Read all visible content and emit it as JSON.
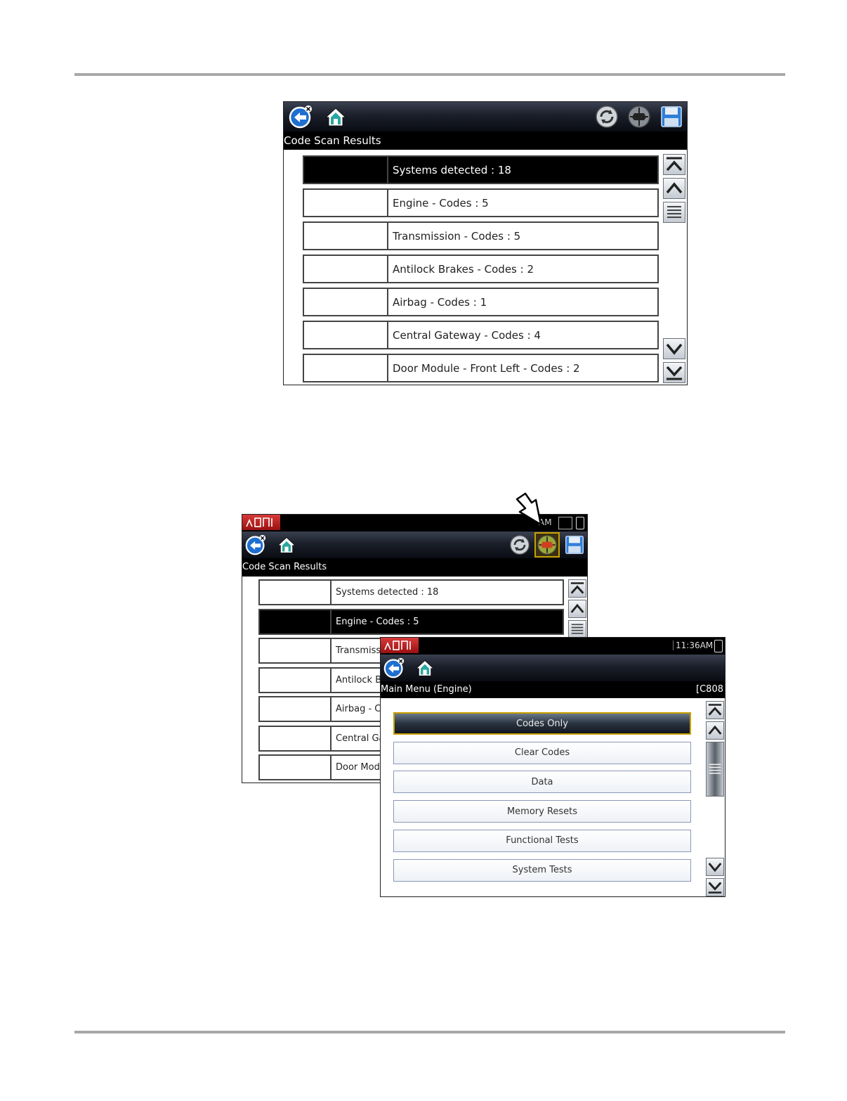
{
  "figure_top": {
    "title": "Code Scan Results",
    "rows": [
      "Systems detected : 18",
      "Engine - Codes : 5",
      "Transmission - Codes : 5",
      "Antilock Brakes - Codes : 2",
      "Airbag - Codes : 1",
      "Central Gateway - Codes : 4",
      "Door Module - Front Left - Codes : 2"
    ],
    "selected_row": 0
  },
  "figure_bottom_back": {
    "title": "Code Scan Results",
    "status_time_partial": "AM",
    "rows": [
      "Systems detected : 18",
      "Engine - Codes : 5",
      "Transmiss",
      "Antilock Br",
      "Airbag - Co",
      "Central Ga",
      "Door Modu"
    ],
    "selected_row": 1
  },
  "figure_bottom_front": {
    "title": "Main Menu (Engine)",
    "title_right": "[C808",
    "status_time": "11:36AM",
    "menu": [
      "Codes Only",
      "Clear Codes",
      "Data",
      "Memory Resets",
      "Functional Tests",
      "System Tests"
    ],
    "selected_menu": 0
  },
  "colors": {
    "toolbar": "#1b1f2a",
    "accent_blue": "#1e6fd0",
    "highlight_gold": "#c8a000",
    "status_red": "#c82020"
  }
}
